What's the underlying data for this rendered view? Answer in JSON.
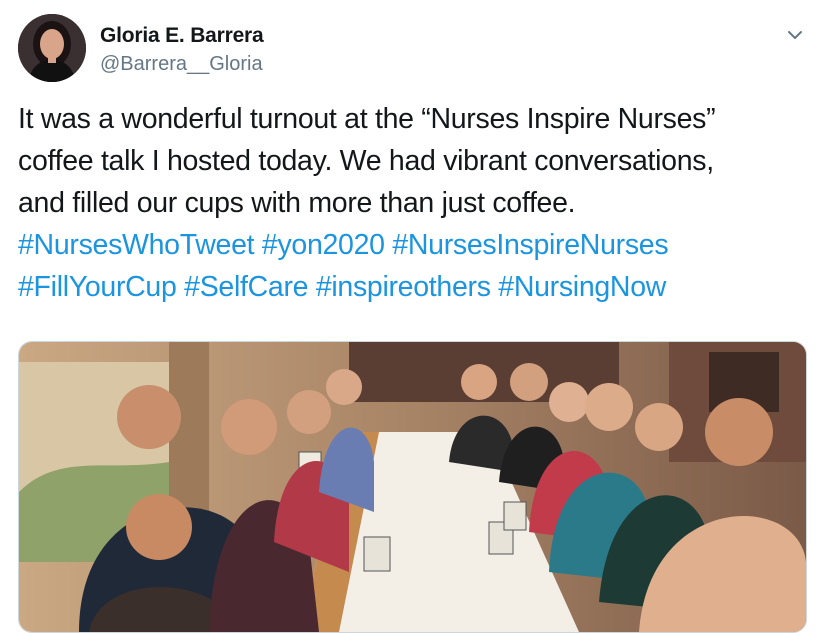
{
  "author": {
    "name": "Gloria E. Barrera",
    "handle": "@Barrera__Gloria"
  },
  "icons": {
    "menu": "chevron-down-icon"
  },
  "tweet": {
    "lines": [
      "It was a wonderful turnout at the “Nurses Inspire Nurses”",
      "coffee talk I hosted today.  We had vibrant conversations,",
      "and filled our cups with more than just coffee."
    ],
    "hashtags_line1": [
      "#NursesWhoTweet",
      "#yon2020",
      "#NursesInspireNurses"
    ],
    "hashtags_line2": [
      "#FillYourCup",
      "#SelfCare",
      "#inspireothers",
      "#NursingNow"
    ]
  },
  "colors": {
    "hashtag": "#1b95e0",
    "handle": "#657786",
    "text": "#14171a"
  }
}
